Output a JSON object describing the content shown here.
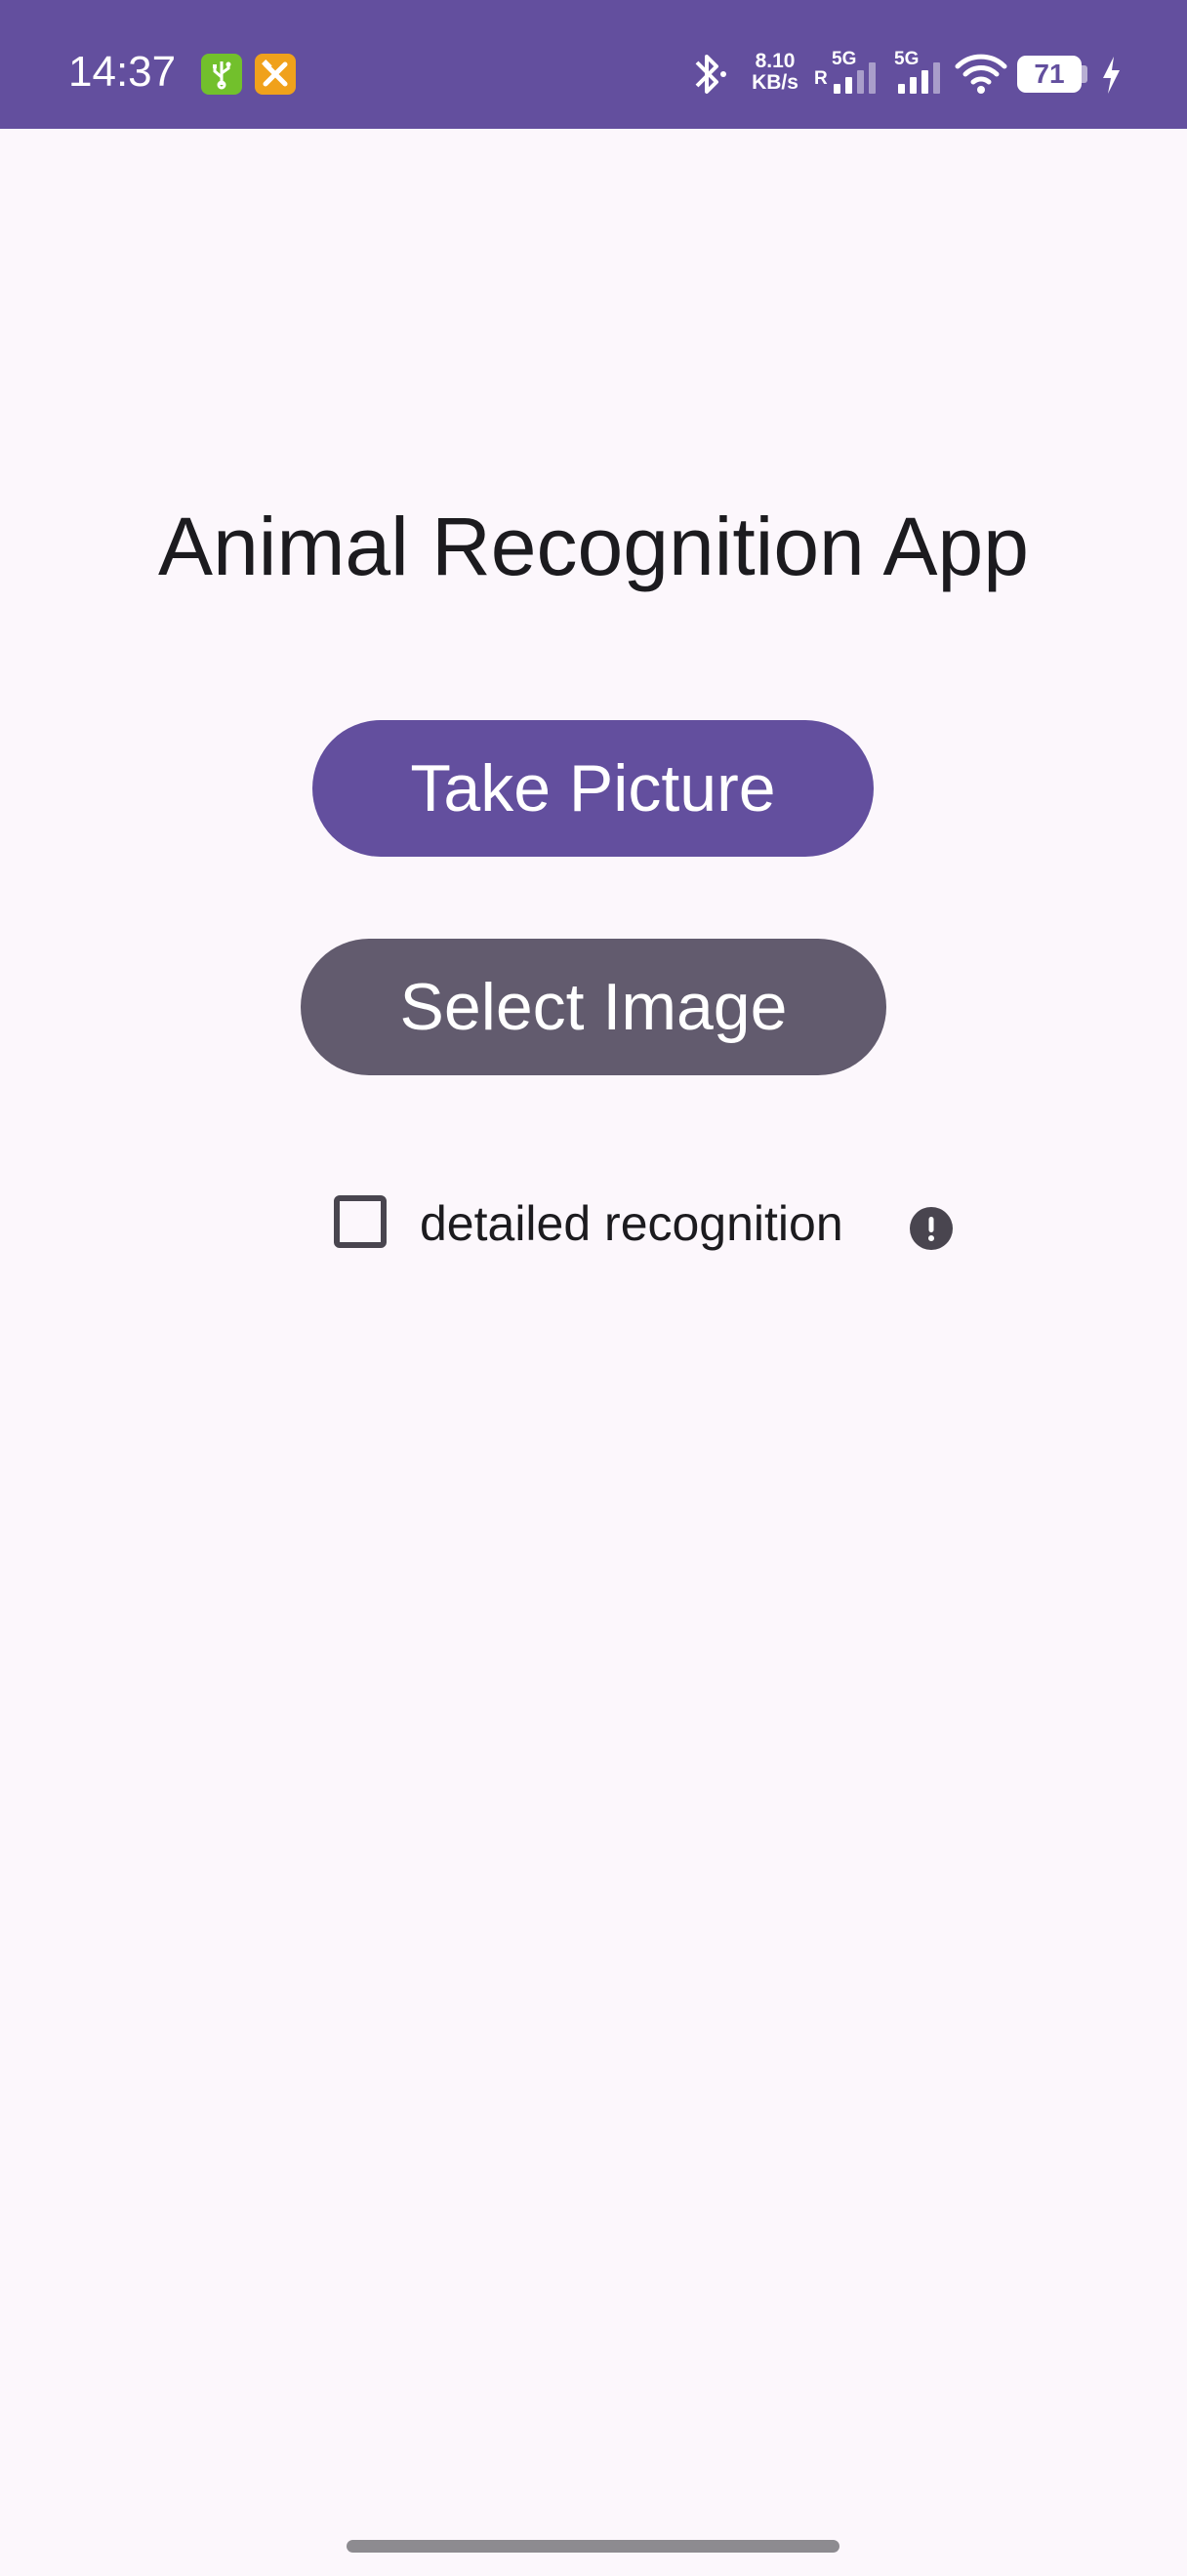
{
  "status_bar": {
    "time": "14:37",
    "net_speed_value": "8.10",
    "net_speed_unit": "KB/s",
    "sim1_label": "5G",
    "sim1_roaming": "R",
    "sim2_label": "5G",
    "battery_level": "71",
    "icons": [
      "usb-debug-icon",
      "tools-icon",
      "bluetooth-icon",
      "signal-sim1-icon",
      "signal-sim2-icon",
      "wifi-icon",
      "battery-icon",
      "charging-bolt-icon"
    ],
    "color": "#634f9e"
  },
  "main": {
    "title": "Animal Recognition App",
    "take_picture_label": "Take Picture",
    "select_image_label": "Select Image",
    "detailed_checkbox_label": "detailed recognition",
    "detailed_checked": false,
    "info_icon": "info-alert-icon"
  },
  "colors": {
    "primary": "#634f9e",
    "secondary": "#625b6e",
    "background": "#fcf7fc",
    "text": "#1c1b1f"
  }
}
